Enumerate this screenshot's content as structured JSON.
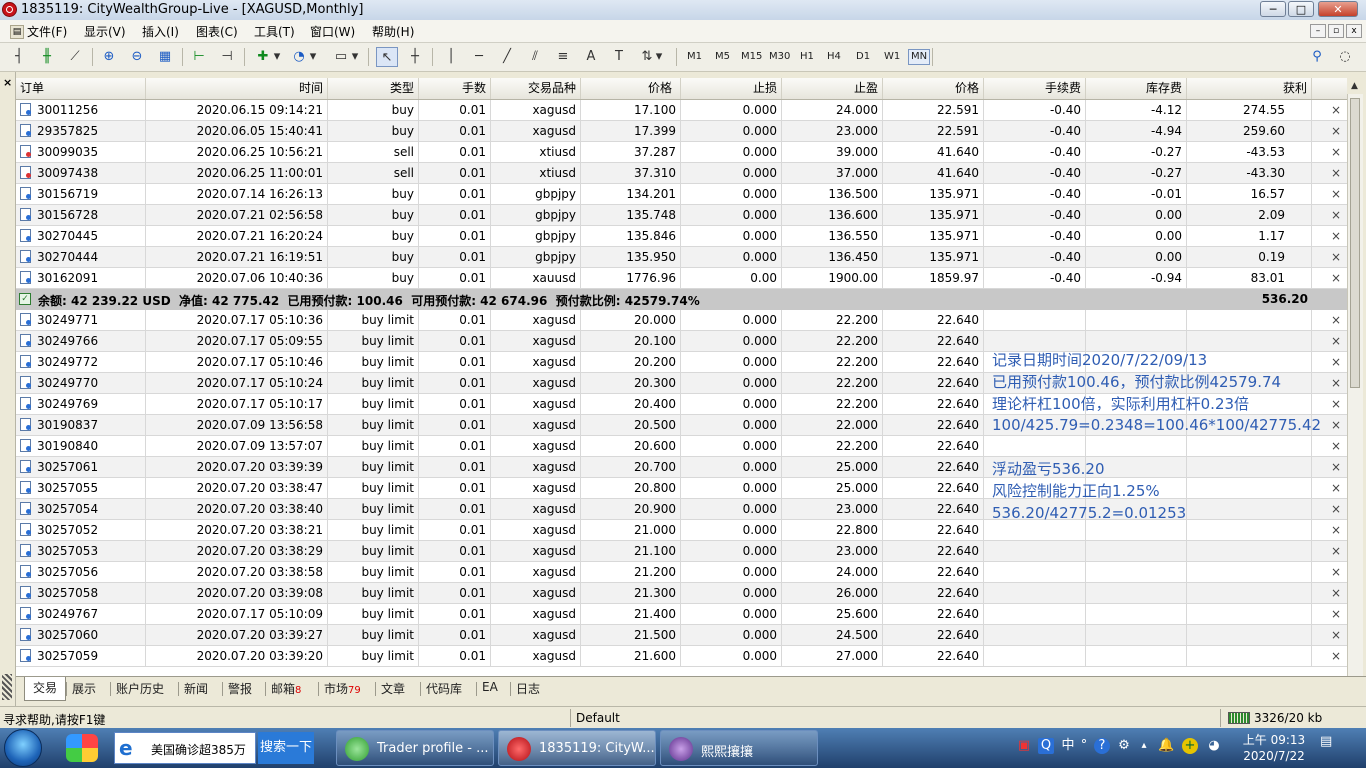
{
  "window": {
    "title": "1835119: CityWealthGroup-Live - [XAGUSD,Monthly]",
    "min": "─",
    "max": "□",
    "close": "✕"
  },
  "menu": [
    {
      "label": "文件(F)"
    },
    {
      "label": "显示(V)"
    },
    {
      "label": "插入(I)"
    },
    {
      "label": "图表(C)"
    },
    {
      "label": "工具(T)"
    },
    {
      "label": "窗口(W)"
    },
    {
      "label": "帮助(H)"
    }
  ],
  "mdi": {
    "min": "–",
    "restore": "▫",
    "close": "x"
  },
  "toolbar": {
    "timeframes": [
      "M1",
      "M5",
      "M15",
      "M30",
      "H1",
      "H4",
      "D1",
      "W1",
      "MN"
    ],
    "selected_timeframe": "MN",
    "text_tool": "A"
  },
  "panel": {
    "close": "×"
  },
  "table": {
    "headers": [
      "订单",
      "时间",
      "类型",
      "手数",
      "交易品种",
      "价格",
      "止损",
      "止盈",
      "价格",
      "手续费",
      "库存费",
      "获利"
    ],
    "sort_mark": "/",
    "close_glyph": "×",
    "positions": [
      [
        "30011256",
        "2020.06.15 09:14:21",
        "buy",
        "0.01",
        "xagusd",
        "17.100",
        "0.000",
        "24.000",
        "22.591",
        "-0.40",
        "-4.12",
        "274.55"
      ],
      [
        "29357825",
        "2020.06.05 15:40:41",
        "buy",
        "0.01",
        "xagusd",
        "17.399",
        "0.000",
        "23.000",
        "22.591",
        "-0.40",
        "-4.94",
        "259.60"
      ],
      [
        "30099035",
        "2020.06.25 10:56:21",
        "sell",
        "0.01",
        "xtiusd",
        "37.287",
        "0.000",
        "39.000",
        "41.640",
        "-0.40",
        "-0.27",
        "-43.53"
      ],
      [
        "30097438",
        "2020.06.25 11:00:01",
        "sell",
        "0.01",
        "xtiusd",
        "37.310",
        "0.000",
        "37.000",
        "41.640",
        "-0.40",
        "-0.27",
        "-43.30"
      ],
      [
        "30156719",
        "2020.07.14 16:26:13",
        "buy",
        "0.01",
        "gbpjpy",
        "134.201",
        "0.000",
        "136.500",
        "135.971",
        "-0.40",
        "-0.01",
        "16.57"
      ],
      [
        "30156728",
        "2020.07.21 02:56:58",
        "buy",
        "0.01",
        "gbpjpy",
        "135.748",
        "0.000",
        "136.600",
        "135.971",
        "-0.40",
        "0.00",
        "2.09"
      ],
      [
        "30270445",
        "2020.07.21 16:20:24",
        "buy",
        "0.01",
        "gbpjpy",
        "135.846",
        "0.000",
        "136.550",
        "135.971",
        "-0.40",
        "0.00",
        "1.17"
      ],
      [
        "30270444",
        "2020.07.21 16:19:51",
        "buy",
        "0.01",
        "gbpjpy",
        "135.950",
        "0.000",
        "136.450",
        "135.971",
        "-0.40",
        "0.00",
        "0.19"
      ],
      [
        "30162091",
        "2020.07.06 10:40:36",
        "buy",
        "0.01",
        "xauusd",
        "1776.96",
        "0.00",
        "1900.00",
        "1859.97",
        "-0.40",
        "-0.94",
        "83.01"
      ]
    ],
    "summary": {
      "text": "余额: 42 239.22 USD  净值: 42 775.42  已用预付款: 100.46  可用预付款: 42 674.96  预付款比例: 42579.74%",
      "profit": "536.20"
    },
    "pending": [
      [
        "30249771",
        "2020.07.17 05:10:36",
        "buy limit",
        "0.01",
        "xagusd",
        "20.000",
        "0.000",
        "22.200",
        "22.640"
      ],
      [
        "30249766",
        "2020.07.17 05:09:55",
        "buy limit",
        "0.01",
        "xagusd",
        "20.100",
        "0.000",
        "22.200",
        "22.640"
      ],
      [
        "30249772",
        "2020.07.17 05:10:46",
        "buy limit",
        "0.01",
        "xagusd",
        "20.200",
        "0.000",
        "22.200",
        "22.640"
      ],
      [
        "30249770",
        "2020.07.17 05:10:24",
        "buy limit",
        "0.01",
        "xagusd",
        "20.300",
        "0.000",
        "22.200",
        "22.640"
      ],
      [
        "30249769",
        "2020.07.17 05:10:17",
        "buy limit",
        "0.01",
        "xagusd",
        "20.400",
        "0.000",
        "22.200",
        "22.640"
      ],
      [
        "30190837",
        "2020.07.09 13:56:58",
        "buy limit",
        "0.01",
        "xagusd",
        "20.500",
        "0.000",
        "22.000",
        "22.640"
      ],
      [
        "30190840",
        "2020.07.09 13:57:07",
        "buy limit",
        "0.01",
        "xagusd",
        "20.600",
        "0.000",
        "22.200",
        "22.640"
      ],
      [
        "30257061",
        "2020.07.20 03:39:39",
        "buy limit",
        "0.01",
        "xagusd",
        "20.700",
        "0.000",
        "25.000",
        "22.640"
      ],
      [
        "30257055",
        "2020.07.20 03:38:47",
        "buy limit",
        "0.01",
        "xagusd",
        "20.800",
        "0.000",
        "25.000",
        "22.640"
      ],
      [
        "30257054",
        "2020.07.20 03:38:40",
        "buy limit",
        "0.01",
        "xagusd",
        "20.900",
        "0.000",
        "23.000",
        "22.640"
      ],
      [
        "30257052",
        "2020.07.20 03:38:21",
        "buy limit",
        "0.01",
        "xagusd",
        "21.000",
        "0.000",
        "22.800",
        "22.640"
      ],
      [
        "30257053",
        "2020.07.20 03:38:29",
        "buy limit",
        "0.01",
        "xagusd",
        "21.100",
        "0.000",
        "23.000",
        "22.640"
      ],
      [
        "30257056",
        "2020.07.20 03:38:58",
        "buy limit",
        "0.01",
        "xagusd",
        "21.200",
        "0.000",
        "24.000",
        "22.640"
      ],
      [
        "30257058",
        "2020.07.20 03:39:08",
        "buy limit",
        "0.01",
        "xagusd",
        "21.300",
        "0.000",
        "26.000",
        "22.640"
      ],
      [
        "30249767",
        "2020.07.17 05:10:09",
        "buy limit",
        "0.01",
        "xagusd",
        "21.400",
        "0.000",
        "25.600",
        "22.640"
      ],
      [
        "30257060",
        "2020.07.20 03:39:27",
        "buy limit",
        "0.01",
        "xagusd",
        "21.500",
        "0.000",
        "24.500",
        "22.640"
      ],
      [
        "30257059",
        "2020.07.20 03:39:20",
        "buy limit",
        "0.01",
        "xagusd",
        "21.600",
        "0.000",
        "27.000",
        "22.640"
      ]
    ]
  },
  "annotation": [
    "记录日期时间2020/7/22/09/13",
    "已用预付款100.46，预付款比例42579.74",
    "理论杆杠100倍，实际利用杠杆0.23倍",
    "100/425.79=0.2348=100.46*100/42775.42",
    "",
    "浮动盈亏536.20",
    "风险控制能力正向1.25%",
    "536.20/42775.2=0.01253"
  ],
  "tabs": [
    {
      "label": "交易"
    },
    {
      "label": "展示"
    },
    {
      "label": "账户历史"
    },
    {
      "label": "新闻"
    },
    {
      "label": "警报"
    },
    {
      "label": "邮箱",
      "badge": "8"
    },
    {
      "label": "市场",
      "badge": "79"
    },
    {
      "label": "文章"
    },
    {
      "label": "代码库"
    },
    {
      "label": "EA"
    },
    {
      "label": "日志"
    }
  ],
  "status": {
    "help": "寻求帮助,请按F1键",
    "profile": "Default",
    "traffic": "3326/20 kb"
  },
  "taskbar": {
    "ie_query": "美国确诊超385万",
    "ie_search": "搜索一下",
    "tasks": [
      {
        "label": "Trader profile - ..."
      },
      {
        "label": "1835119: CityW..."
      },
      {
        "label": "熙熙攘攘"
      }
    ],
    "ime": "中",
    "clock_time": "上午 09:13",
    "clock_date": "2020/7/22"
  }
}
